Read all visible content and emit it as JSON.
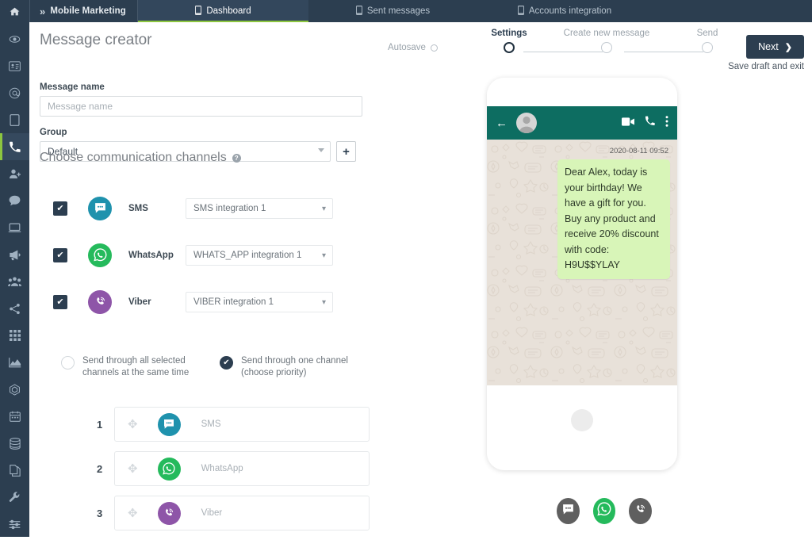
{
  "topbar": {
    "home_icon": "home-icon",
    "brand": "Mobile Marketing",
    "brand_chevron": "»",
    "tabs": [
      {
        "label": "Dashboard",
        "icon": "mobile-icon",
        "active": true
      },
      {
        "label": "Sent messages",
        "icon": "mobile-icon",
        "active": false
      },
      {
        "label": "Accounts integration",
        "icon": "mobile-icon",
        "active": false
      }
    ]
  },
  "sidebar": {
    "items": [
      {
        "name": "eye-icon"
      },
      {
        "name": "id-card-icon"
      },
      {
        "name": "at-circle-icon"
      },
      {
        "name": "square-icon"
      },
      {
        "name": "phone-icon",
        "active": true
      },
      {
        "name": "user-plus-icon"
      },
      {
        "name": "chat-bubble-icon"
      },
      {
        "name": "laptop-icon"
      },
      {
        "name": "megaphone-icon"
      },
      {
        "name": "users-group-icon"
      },
      {
        "name": "share-nodes-icon"
      },
      {
        "name": "grid-icon"
      },
      {
        "name": "chart-area-icon"
      },
      {
        "name": "hexagon-icon"
      },
      {
        "name": "calendar-icon"
      },
      {
        "name": "database-icon"
      },
      {
        "name": "copy-files-icon"
      },
      {
        "name": "wrench-icon"
      },
      {
        "name": "sliders-icon"
      }
    ]
  },
  "header": {
    "page_title": "Message creator",
    "autosave_label": "Autosave",
    "next_label": "Next",
    "next_chevron": "❯",
    "save_draft_label": "Save draft and exit"
  },
  "steps": [
    {
      "label": "Settings",
      "current": true
    },
    {
      "label": "Create new message",
      "current": false
    },
    {
      "label": "Send",
      "current": false
    }
  ],
  "form": {
    "message_name_label": "Message name",
    "message_name_value": "",
    "message_name_placeholder": "Message name",
    "group_label": "Group",
    "group_value": "Default",
    "add_group_label": "+"
  },
  "channels_section": {
    "title": "Choose communication channels",
    "help_glyph": "?",
    "rows": [
      {
        "name": "SMS",
        "checked": true,
        "integration": "SMS integration 1",
        "icon": "sms-icon",
        "color": "#1f92ad"
      },
      {
        "name": "WhatsApp",
        "checked": true,
        "integration": "WHATS_APP integration 1",
        "icon": "whatsapp-icon",
        "color": "#25ba5c"
      },
      {
        "name": "Viber",
        "checked": true,
        "integration": "VIBER integration 1",
        "icon": "viber-icon",
        "color": "#8e55a8"
      }
    ]
  },
  "send_mode": {
    "option_all": "Send through all selected channels at the same time",
    "option_all_line1": "Send through all selected",
    "option_all_line2": "channels at the same time",
    "option_all_selected": false,
    "option_one": "Send through one channel (choose priority)",
    "option_one_line1": "Send through one channel",
    "option_one_line2": "(choose priority)",
    "option_one_selected": true
  },
  "priority": [
    {
      "index": "1",
      "label": "SMS",
      "icon": "sms-icon",
      "color": "#1f92ad",
      "drag": "✥"
    },
    {
      "index": "2",
      "label": "WhatsApp",
      "icon": "whatsapp-icon",
      "color": "#25ba5c",
      "drag": "✥"
    },
    {
      "index": "3",
      "label": "Viber",
      "icon": "viber-icon",
      "color": "#8e55a8",
      "drag": "✥"
    }
  ],
  "preview": {
    "wa_back_glyph": "←",
    "timestamp": "2020-08-11 09:52",
    "message_text": "Dear Alex, today is your birthday! We have a gift for you. Buy any product and receive 20% discount with code: H9U$$YLAY",
    "channel_toggles": [
      {
        "name": "sms-icon",
        "active": false
      },
      {
        "name": "whatsapp-icon",
        "active": true
      },
      {
        "name": "viber-icon",
        "active": false
      }
    ]
  },
  "colors": {
    "nav_dark": "#2c3e50",
    "accent_green": "#8cc63f",
    "whatsapp_header": "#0d6d61",
    "bubble_green": "#d8f5b8",
    "sms_blue": "#1f92ad",
    "whatsapp_green": "#25ba5c",
    "viber_purple": "#8e55a8"
  }
}
